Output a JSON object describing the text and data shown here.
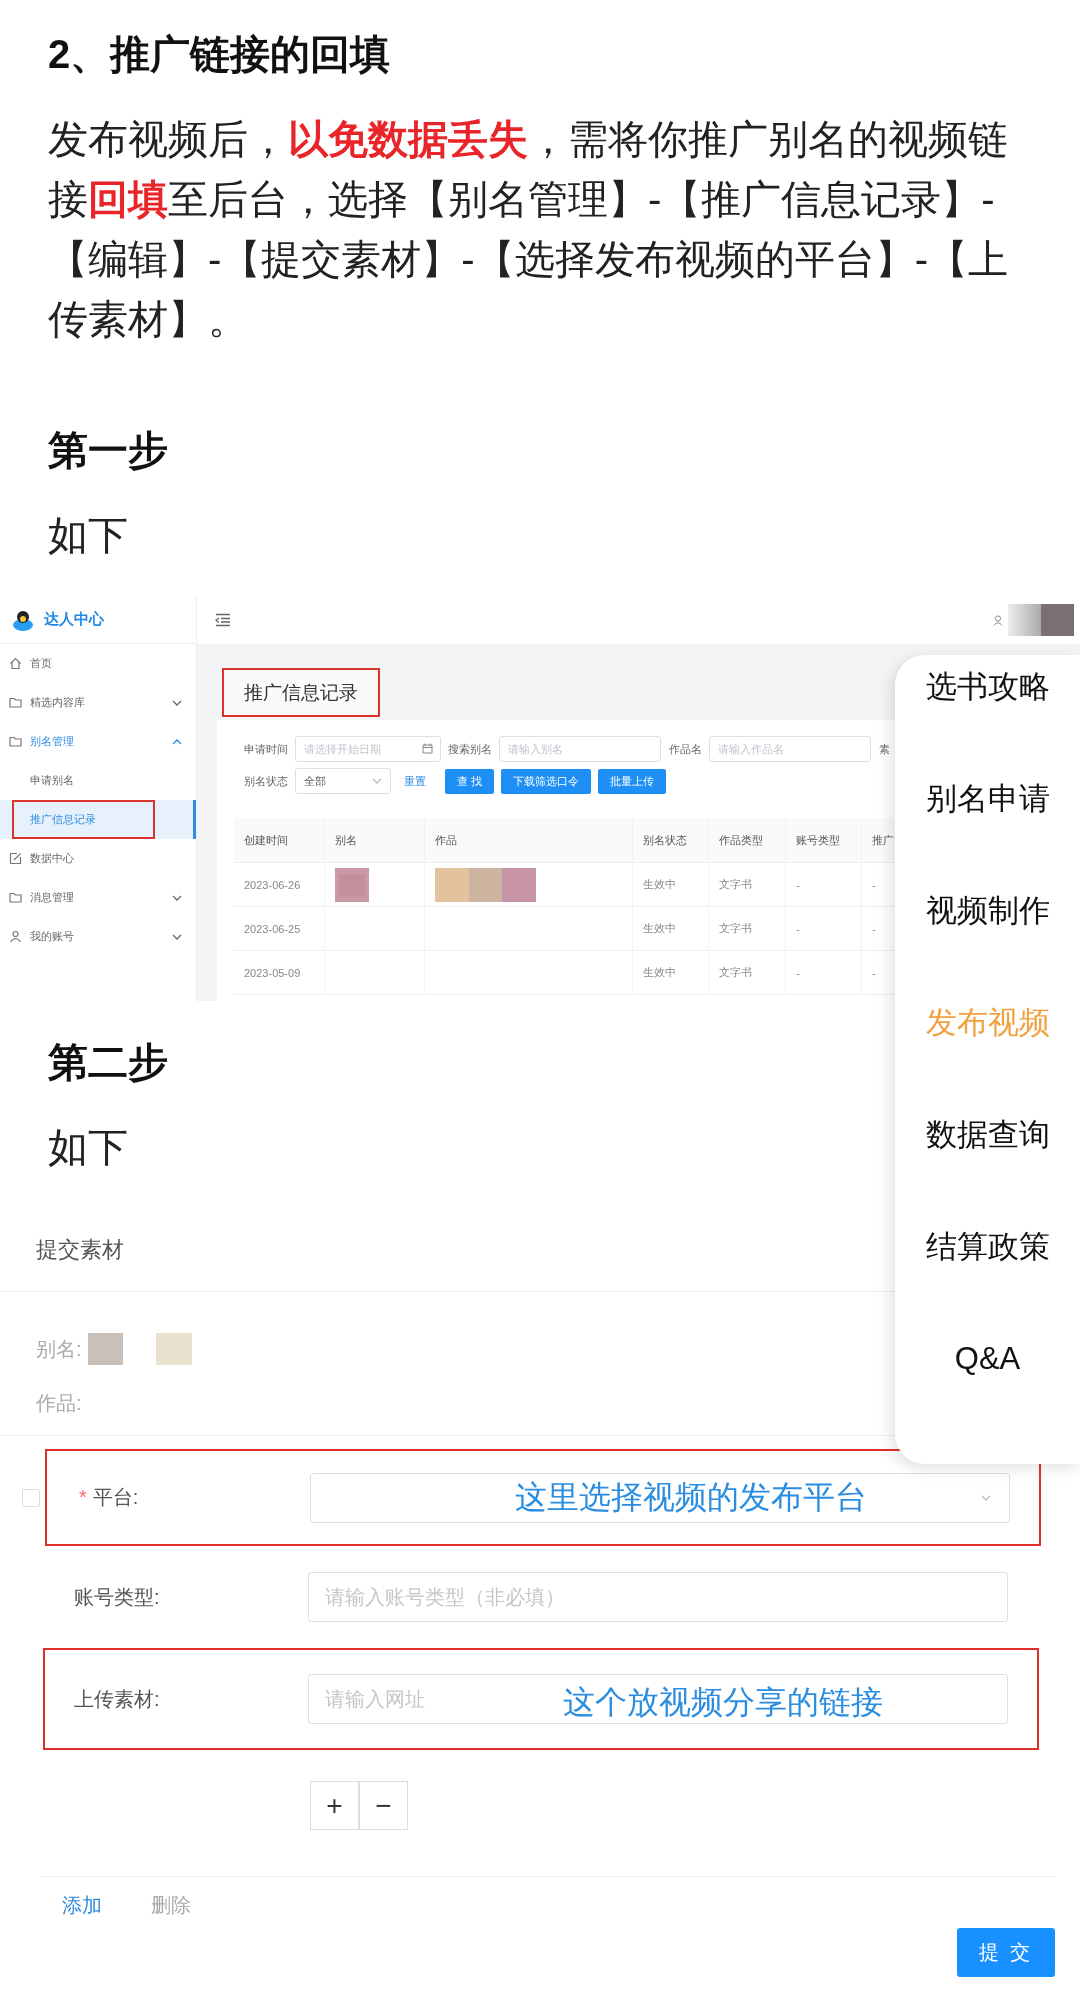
{
  "article": {
    "heading": "2、推广链接的回填",
    "paragraph": "发布视频后，**以免数据丢失**，需将你推广别名的视频链接**回填**至后台，选择【别名管理】-【推广信息记录】-【编辑】-【提交素材】-【选择发布视频的平台】-【上传素材】。"
  },
  "steps": [
    {
      "title": "第一步",
      "caption": "如下",
      "screen": {
        "kind": "records",
        "brand": "达人中心",
        "nav": [
          {
            "label": "首页",
            "selected": false
          },
          {
            "label": "精选内容库",
            "selected": false,
            "expanded": false
          },
          {
            "label": "别名管理",
            "selected": true,
            "expanded": true,
            "children": [
              {
                "label": "申请别名",
                "selected": false
              },
              {
                "label": "推广信息记录",
                "selected": true,
                "annotated": true
              }
            ]
          },
          {
            "label": "数据中心",
            "selected": false
          },
          {
            "label": "消息管理",
            "selected": false,
            "expanded": false
          },
          {
            "label": "我的账号",
            "selected": false,
            "expanded": false
          }
        ],
        "page_title": {
          "text": "推广信息记录",
          "annotated": true
        },
        "filters": [
          [
            {
              "label": "申请时间",
              "kind": "date",
              "placeholder": "请选择开始日期"
            },
            {
              "label": "搜索别名",
              "kind": "text",
              "placeholder": "请输入别名"
            },
            {
              "label": "作品名",
              "kind": "text",
              "placeholder": "请输入作品名"
            },
            {
              "label": "素",
              "kind": "label"
            }
          ],
          [
            {
              "label": "别名状态",
              "kind": "select",
              "value": "全部"
            },
            {
              "label": "重置",
              "kind": "link"
            },
            {
              "label": "查 找",
              "kind": "button"
            },
            {
              "label": "下载筛选口令",
              "kind": "button"
            },
            {
              "label": "批量上传",
              "kind": "button"
            }
          ]
        ],
        "table": {
          "columns": [
            "创建时间",
            "别名",
            "作品",
            "别名状态",
            "作品类型",
            "账号类型",
            "推广"
          ],
          "rows": [
            {
              "created": "2023-06-26",
              "status": "生效中",
              "work_type": "文字书",
              "account_type": "-",
              "promotion": "-"
            },
            {
              "created": "2023-06-25",
              "status": "生效中",
              "work_type": "文字书",
              "account_type": "-",
              "promotion": "-"
            },
            {
              "created": "2023-05-09",
              "status": "生效中",
              "work_type": "文字书",
              "account_type": "-",
              "promotion": "-"
            }
          ]
        }
      }
    },
    {
      "title": "第二步",
      "caption": "如下",
      "screen": {
        "kind": "form",
        "title": "提交素材",
        "info": [
          {
            "label": "别名:"
          },
          {
            "label": "作品:"
          }
        ],
        "rows": [
          {
            "label": "平台:",
            "kind": "select",
            "required_mark": "*",
            "checked": false,
            "annotated": true,
            "note": "这里选择视频的发布平台"
          },
          {
            "label": "账号类型:",
            "kind": "text",
            "placeholder": "请输入账号类型（非必填）"
          },
          {
            "label": "上传素材:",
            "kind": "text",
            "annotated": true,
            "placeholder": "请输入网址",
            "note": "这个放视频分享的链接"
          }
        ],
        "stepper": [
          "+",
          "−"
        ],
        "actions": [
          {
            "label": "添加",
            "disabled": false
          },
          {
            "label": "删除",
            "disabled": true
          }
        ],
        "submit": "提 交"
      }
    }
  ],
  "side_menu": [
    {
      "label": "选书攻略",
      "selected": false
    },
    {
      "label": "别名申请",
      "selected": false
    },
    {
      "label": "视频制作",
      "selected": false
    },
    {
      "label": "发布视频",
      "selected": true
    },
    {
      "label": "数据查询",
      "selected": false
    },
    {
      "label": "结算政策",
      "selected": false
    },
    {
      "label": "Q&A",
      "selected": false
    }
  ]
}
